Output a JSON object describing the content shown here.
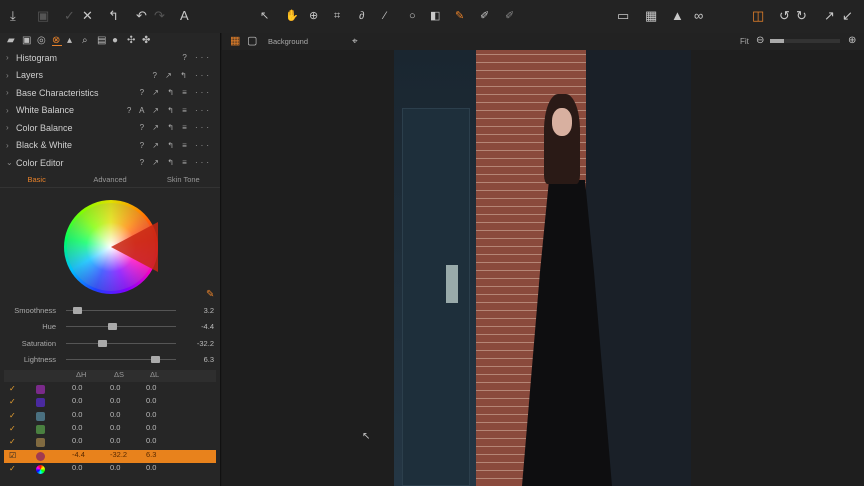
{
  "toolbar": {
    "font_icon_label": "A",
    "zoom_fit": "Fit",
    "layer_name": "Background"
  },
  "tools": [
    {
      "label": "Histogram",
      "expanded": false
    },
    {
      "label": "Layers",
      "expanded": false
    },
    {
      "label": "Base Characteristics",
      "expanded": false
    },
    {
      "label": "White Balance",
      "expanded": false
    },
    {
      "label": "Color Balance",
      "expanded": false
    },
    {
      "label": "Black & White",
      "expanded": false
    },
    {
      "label": "Color Editor",
      "expanded": true
    }
  ],
  "color_editor": {
    "tabs": [
      "Basic",
      "Advanced",
      "Skin Tone"
    ],
    "active_tab": "Basic",
    "sliders": [
      {
        "label": "Smoothness",
        "value": "3.2",
        "pos": 0.1
      },
      {
        "label": "Hue",
        "value": "-4.4",
        "pos": 0.42
      },
      {
        "label": "Saturation",
        "value": "-32.2",
        "pos": 0.33
      },
      {
        "label": "Lightness",
        "value": "6.3",
        "pos": 0.81
      }
    ],
    "columns": [
      "ΔH",
      "ΔS",
      "ΔL"
    ],
    "rows": [
      {
        "color": "#7a2a8a",
        "dh": "0.0",
        "ds": "0.0",
        "dl": "0.0",
        "selected": false
      },
      {
        "color": "#4a2aa0",
        "dh": "0.0",
        "ds": "0.0",
        "dl": "0.0",
        "selected": false
      },
      {
        "color": "#4a7080",
        "dh": "0.0",
        "ds": "0.0",
        "dl": "0.0",
        "selected": false
      },
      {
        "color": "#4a8040",
        "dh": "0.0",
        "ds": "0.0",
        "dl": "0.0",
        "selected": false
      },
      {
        "color": "#806a40",
        "dh": "0.0",
        "ds": "0.0",
        "dl": "0.0",
        "selected": false
      },
      {
        "color": "#a03a50",
        "dh": "-4.4",
        "ds": "-32.2",
        "dl": "6.3",
        "selected": true
      },
      {
        "color": "rainbow",
        "dh": "0.0",
        "ds": "0.0",
        "dl": "0.0",
        "selected": false
      }
    ]
  }
}
